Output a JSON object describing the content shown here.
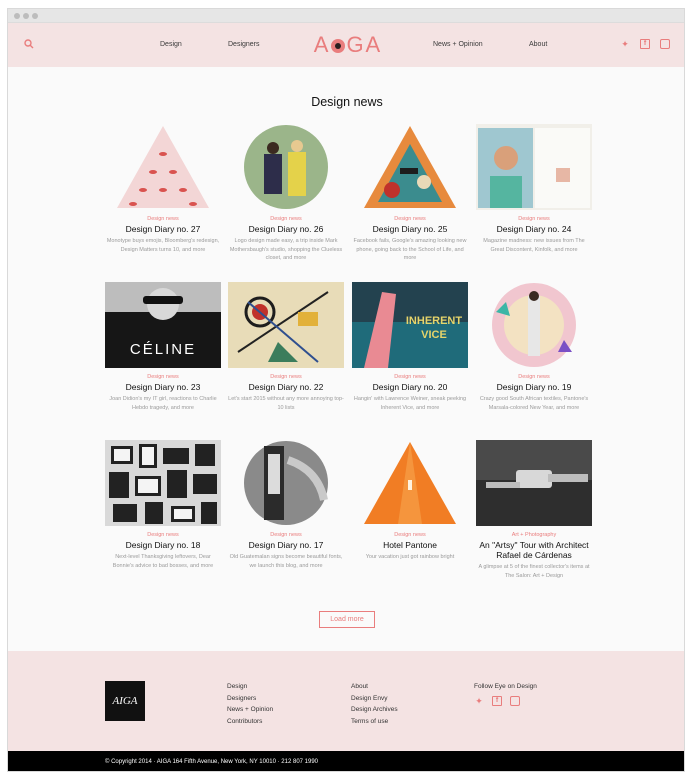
{
  "header": {
    "nav_left": [
      "Design",
      "Designers"
    ],
    "logo": {
      "before": "A",
      "after": "GA"
    },
    "nav_right": [
      "News + Opinion",
      "About"
    ],
    "icons": [
      "search-icon",
      "twitter-icon",
      "facebook-icon",
      "instagram-icon"
    ]
  },
  "main": {
    "title": "Design news",
    "cards": [
      {
        "category": "Design news",
        "title": "Design Diary no. 27",
        "desc": "Monotype buys emojis, Bloomberg's redesign, Design Matters turns 10, and more",
        "shape": "triangle"
      },
      {
        "category": "Design news",
        "title": "Design Diary no. 26",
        "desc": "Logo design made easy, a trip inside Mark Mothersbaugh's studio, shopping the Clueless closet, and more",
        "shape": "circle"
      },
      {
        "category": "Design news",
        "title": "Design Diary no. 25",
        "desc": "Facebook fails, Google's amazing looking new phone, going back to the School of Life, and more",
        "shape": "triangle"
      },
      {
        "category": "Design news",
        "title": "Design Diary no. 24",
        "desc": "Magazine madness: new issues from The Great Discontent, Kinfolk, and more",
        "shape": "square"
      },
      {
        "category": "Design news",
        "title": "Design Diary no. 23",
        "desc": "Joan Didion's my IT girl, reactions to Charlie Hebdo tragedy, and more",
        "shape": "square"
      },
      {
        "category": "Design news",
        "title": "Design Diary no. 22",
        "desc": "Let's start 2015 without any more annoying top-10 lists",
        "shape": "square"
      },
      {
        "category": "Design news",
        "title": "Design Diary no. 20",
        "desc": "Hangin' with Lawrence Weiner, sneak peeking Inherent Vice, and more",
        "shape": "square"
      },
      {
        "category": "Design news",
        "title": "Design Diary no. 19",
        "desc": "Crazy good South African textiles, Pantone's Marsala-colored New Year, and more",
        "shape": "circle"
      },
      {
        "category": "Design news",
        "title": "Design Diary no. 18",
        "desc": "Next-level Thanksgiving leftovers, Dear Bonnie's advice to bad bosses, and more",
        "shape": "square"
      },
      {
        "category": "Design news",
        "title": "Design Diary no. 17",
        "desc": "Old Guatemalan signs become beautiful fonts, we launch this blog, and more",
        "shape": "circle"
      },
      {
        "category": "Design news",
        "title": "Hotel Pantone",
        "desc": "Your vacation just got rainbow bright",
        "shape": "triangle"
      },
      {
        "category": "Art + Photography",
        "title": "An \"Artsy\" Tour with Architect Rafael de Cárdenas",
        "desc": "A glimpse at 5 of the finest collector's items at The Salon: Art + Design",
        "shape": "square"
      }
    ],
    "load_more": "Load more"
  },
  "footer": {
    "logo": "AIGA",
    "col1": [
      "Design",
      "Designers",
      "News + Opinion",
      "Contributors"
    ],
    "col2": [
      "About",
      "Design Envy",
      "Design Archives",
      "Terms of use"
    ],
    "follow": "Follow Eye on Design",
    "copyright": "© Copyright 2014 · AIGA 164 Fifth Avenue, New York, NY 10010 · 212 807 1990"
  },
  "colors": {
    "accent": "#e97d7d",
    "header_bg": "#f4e3e3",
    "text": "#111111"
  }
}
